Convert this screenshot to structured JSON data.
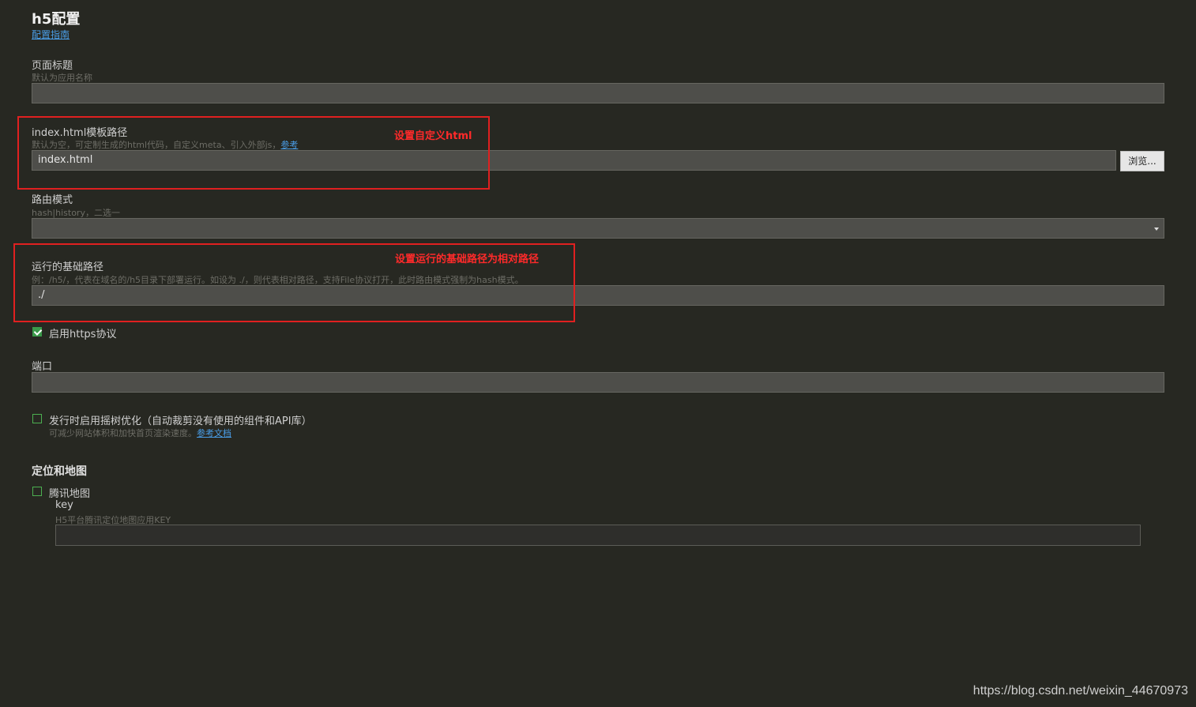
{
  "header": {
    "title": "h5配置",
    "guide_link": "配置指南"
  },
  "page_title_field": {
    "label": "页面标题",
    "hint": "默认为应用名称",
    "value": ""
  },
  "template_field": {
    "label": "index.html模板路径",
    "hint": "默认为空，可定制生成的html代码，自定义meta、引入外部js，",
    "hint_link": "参考",
    "value": "index.html",
    "browse_label": "浏览..."
  },
  "router_field": {
    "label": "路由模式",
    "hint": "hash|history，二选一",
    "value": "",
    "icon": "chevron-down-icon"
  },
  "base_path_field": {
    "label": "运行的基础路径",
    "hint": "例：/h5/，代表在域名的/h5目录下部署运行。如设为 ./，则代表相对路径，支持File协议打开，此时路由模式强制为hash模式。",
    "value": "./"
  },
  "https_option": {
    "label": "启用https协议",
    "checked": true
  },
  "port_field": {
    "label": "端口",
    "value": ""
  },
  "treeshake_option": {
    "label": "发行时启用摇树优化（自动裁剪没有使用的组件和API库）",
    "hint": "可减少网站体积和加快首页渲染速度。",
    "hint_link": "参考文档",
    "checked": false
  },
  "location_section": {
    "title": "定位和地图",
    "tencent_map": {
      "label": "腾讯地图",
      "checked": false,
      "key_label": "key",
      "key_hint": "H5平台腾讯定位地图应用KEY",
      "key_value": ""
    }
  },
  "annotations": {
    "custom_html": "设置自定义html",
    "relative_path": "设置运行的基础路径为相对路径",
    "color": "#e02020"
  },
  "watermark": "https://blog.csdn.net/weixin_44670973"
}
